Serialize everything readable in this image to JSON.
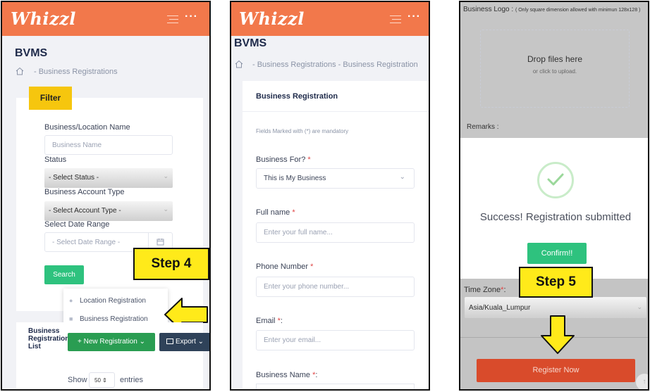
{
  "app": {
    "logo_text": "Whizzl",
    "more_glyph": "···"
  },
  "panel1": {
    "title": "BVMS",
    "breadcrumb": "- Business Registrations",
    "filter_label": "Filter",
    "fields": {
      "business_location_label": "Business/Location Name",
      "business_name_placeholder": "Business Name",
      "status_label": "Status",
      "status_value": "- Select Status -",
      "account_type_label": "Business Account Type",
      "account_type_value": "- Select Account Type -",
      "date_range_label": "Select Date Range",
      "date_range_value": "- Select Date Range -"
    },
    "search_button": "Search",
    "step_label": "Step 4",
    "dropdown": {
      "location_registration": "Location Registration",
      "business_registration": "Business Registration"
    },
    "list_title": "Business Registration List",
    "new_registration_button": "+ New Registration ⌄",
    "export_button": "Export ⌄",
    "show_label": "Show",
    "entries_value": "50",
    "entries_label": "entries"
  },
  "panel2": {
    "title": "BVMS",
    "breadcrumb": "- Business Registrations - Business Registration",
    "card_title": "Business Registration",
    "mandatory_note": "Fields Marked with (*) are mandatory",
    "business_for_label": "Business For?",
    "business_for_value": "This is My Business",
    "full_name_label": "Full name",
    "full_name_placeholder": "Enter your full name...",
    "phone_label": "Phone Number",
    "phone_placeholder": "Enter your phone number...",
    "email_label": "Email",
    "email_placeholder": "Enter your email...",
    "business_name_label": "Business Name",
    "required_mark": "*",
    "colon": ":"
  },
  "panel3": {
    "logo_label": "Business Logo :",
    "logo_note": "( Only square dimension allowed with minimun 128x128 )",
    "drop_title": "Drop files here",
    "drop_sub": "or click to upload.",
    "remarks_label": "Remarks :",
    "success_text": "Success! Registration submitted",
    "confirm_button": "Confirm!!",
    "step_label": "Step 5",
    "timezone_label": "Time Zone",
    "timezone_value": "Asia/Kuala_Lumpur",
    "register_button": "Register Now"
  },
  "colors": {
    "brand": "#f2784b",
    "success": "#2ec27e",
    "step": "#ffea1a",
    "filter": "#f6c60e",
    "export": "#2f4259",
    "register": "#d94b2b"
  },
  "icons": [
    "home-icon",
    "menu-icon",
    "more-icon",
    "calendar-icon",
    "location-pin-icon",
    "briefcase-icon",
    "export-icon",
    "chevron-down-icon",
    "checkmark-icon",
    "arrow-left-icon",
    "arrow-down-icon"
  ]
}
